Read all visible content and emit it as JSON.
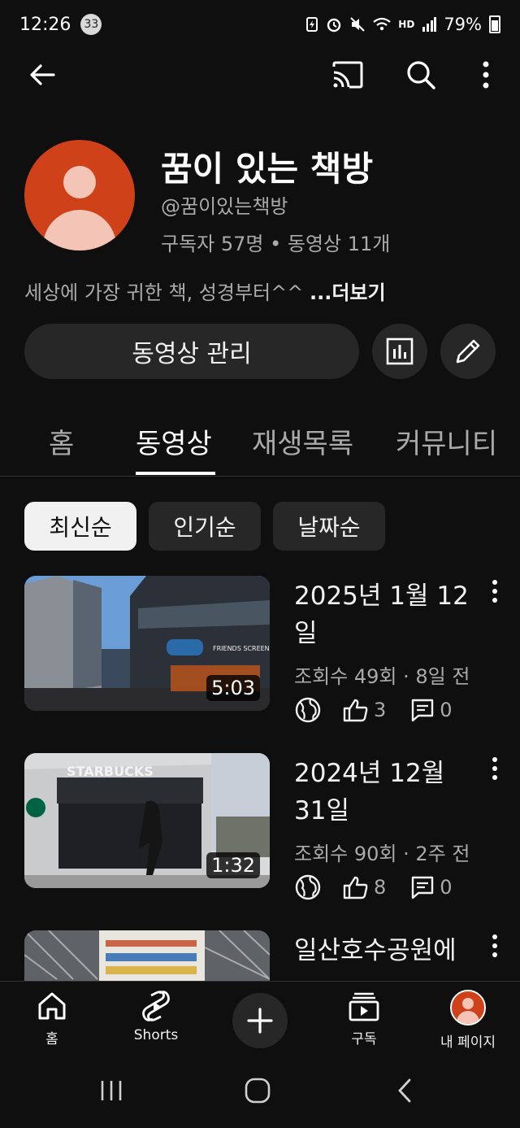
{
  "status_bar": {
    "time": "12:26",
    "notification_count": "33",
    "network_label": "HD",
    "battery": "79%"
  },
  "channel": {
    "name": "꿈이 있는 책방",
    "handle": "@꿈이있는책방",
    "stats": "구독자 57명 • 동영상 11개",
    "description": "세상에 가장 귀한 책, 성경부터^^",
    "more_label": "...더보기",
    "manage_button": "동영상 관리"
  },
  "tabs": [
    "홈",
    "동영상",
    "재생목록",
    "커뮤니티"
  ],
  "active_tab": "동영상",
  "chips": [
    "최신순",
    "인기순",
    "날짜순"
  ],
  "active_chip": "최신순",
  "videos": [
    {
      "title": "2025년 1월 12일",
      "meta": "조회수 49회 · 8일 전",
      "duration": "5:03",
      "likes": "3",
      "comments": "0",
      "thumb_text": "FRIENDS SCREEN"
    },
    {
      "title": "2024년 12월 31일",
      "meta": "조회수 90회 · 2주 전",
      "duration": "1:32",
      "likes": "8",
      "comments": "0",
      "thumb_text": "STARBUCKS"
    },
    {
      "title": "일산호수공원에",
      "meta": "",
      "duration": "",
      "likes": "",
      "comments": ""
    }
  ],
  "bottom_nav": {
    "home": "홈",
    "shorts": "Shorts",
    "subscriptions": "구독",
    "you": "내 페이지"
  },
  "colors": {
    "background": "#0f0f0f",
    "surface": "#272727",
    "avatar": "#cf4219",
    "text_secondary": "#aaaaaa"
  }
}
